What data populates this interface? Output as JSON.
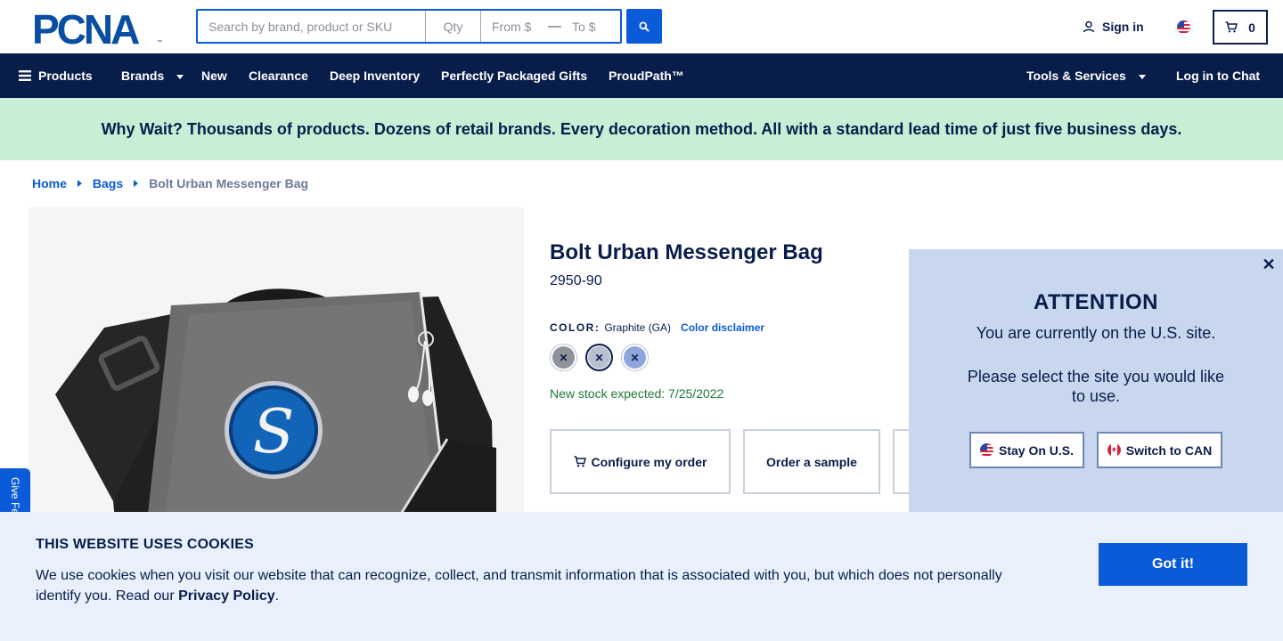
{
  "header": {
    "logo_text": "PCNA",
    "search_placeholder": "Search by brand, product or SKU",
    "qty_placeholder": "Qty",
    "from_placeholder": "From $",
    "to_placeholder": "To $",
    "signin_label": "Sign in",
    "cart_count": "0"
  },
  "nav": {
    "products": "Products",
    "brands": "Brands",
    "new": "New",
    "clearance": "Clearance",
    "deep_inventory": "Deep Inventory",
    "gifts": "Perfectly Packaged Gifts",
    "proudpath": "ProudPath™",
    "tools": "Tools & Services",
    "chat": "Log in to Chat"
  },
  "promo": {
    "text": "Why Wait? Thousands of products. Dozens of retail brands. Every decoration method. All with a standard lead time of just five business days."
  },
  "breadcrumb": {
    "home": "Home",
    "bags": "Bags",
    "current": "Bolt Urban Messenger Bag"
  },
  "product": {
    "title": "Bolt Urban Messenger Bag",
    "sku": "2950-90",
    "color_label": "COLOR:",
    "color_value": "Graphite (GA)",
    "color_disclaimer": "Color disclaimer",
    "swatches": [
      {
        "name": "gray",
        "color": "#8f9398"
      },
      {
        "name": "graphite",
        "color": "#b7c0cf"
      },
      {
        "name": "blue",
        "color": "#8ea4dc"
      }
    ],
    "stock": "New stock expected: 7/25/2022",
    "configure_label": "Configure my order",
    "sample_label": "Order a sample"
  },
  "attention": {
    "title": "ATTENTION",
    "line1": "You are currently on the U.S. site.",
    "line2": "Please select the site you would like to use.",
    "stay_label": "Stay On U.S.",
    "switch_label": "Switch to CAN"
  },
  "feedback": {
    "label": "Give Feedback"
  },
  "cookie": {
    "title": "THIS WEBSITE USES COOKIES",
    "text": "We use cookies when you visit our website that can recognize, collect, and transmit information that is associated with you, but which does not personally identify you. Read our ",
    "link": "Privacy Policy",
    "end": ".",
    "button": "Got it!"
  },
  "colors": {
    "navy": "#091d4a",
    "brand_blue": "#0a5bd8",
    "promo_green": "#c7efd6",
    "modal_blue": "#c8d6ee",
    "cookie_bg": "#e9f0fb"
  }
}
